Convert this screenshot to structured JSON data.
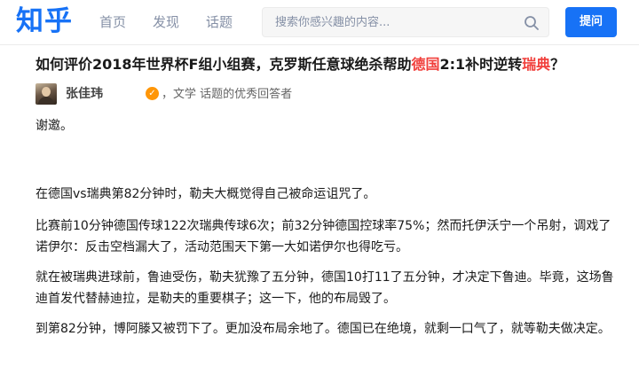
{
  "header": {
    "logo": "知乎",
    "nav": [
      "首页",
      "发现",
      "话题"
    ],
    "search_placeholder": "搜索你感兴趣的内容...",
    "ask_label": "提问",
    "brand_color": "#1772f6"
  },
  "question": {
    "title_part1": "如何评价2018年世界杯F组小组赛，克罗斯任意球绝杀帮助",
    "title_team1": "德国",
    "title_part2": "2:1补时逆转",
    "title_team2": "瑞典",
    "title_part3": "？",
    "highlight_color": "#f1403c"
  },
  "answer": {
    "author_name": "张佳玮",
    "badge_icon": "badge-icon",
    "author_desc": "，文学 话题的优秀回答者",
    "paragraphs": [
      "谢邀。",
      "在德国vs瑞典第82分钟时，勒夫大概觉得自己被命运诅咒了。",
      "比赛前10分钟德国传球122次瑞典传球6次；前32分钟德国控球率75%；然而托伊沃宁一个吊射，调戏了诺伊尔：反击空档漏大了，活动范围天下第一大如诺伊尔也得吃亏。",
      "就在被瑞典进球前，鲁迪受伤，勒夫犹豫了五分钟，德国10打11了五分钟，才决定下鲁迪。毕竟，这场鲁迪首发代替赫迪拉，是勒夫的重要棋子；这一下，他的布局毁了。",
      "到第82分钟，博阿滕又被罚下了。更加没布局余地了。德国已在绝境，就剩一口气了，就等勒夫做决定。"
    ]
  }
}
